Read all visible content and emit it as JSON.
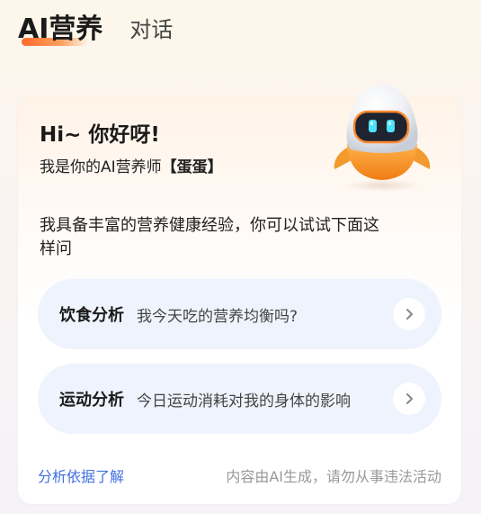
{
  "header": {
    "active_tab": "AI营养",
    "inactive_tab": "对话"
  },
  "card": {
    "greeting_title": "Hi~ 你好呀!",
    "greeting_sub_prefix": "我是你的AI营养师",
    "greeting_sub_name": "【蛋蛋】",
    "intro": "我具备丰富的营养健康经验，你可以试试下面这样问",
    "mascot_icon": "egg-robot-mascot-icon",
    "suggestions": [
      {
        "label": "饮食分析",
        "text": "我今天吃的营养均衡吗?",
        "icon": "chevron-right-icon"
      },
      {
        "label": "运动分析",
        "text": "今日运动消耗对我的身体的影响",
        "icon": "chevron-right-icon"
      }
    ],
    "footer_link": "分析依据了解",
    "footer_note": "内容由AI生成，请勿从事违法活动"
  },
  "colors": {
    "accent_orange": "#ff6a2b",
    "link_blue": "#3f6fe0",
    "pill_background": "#eef3fd",
    "mascot_eye": "#4fe3ff"
  }
}
